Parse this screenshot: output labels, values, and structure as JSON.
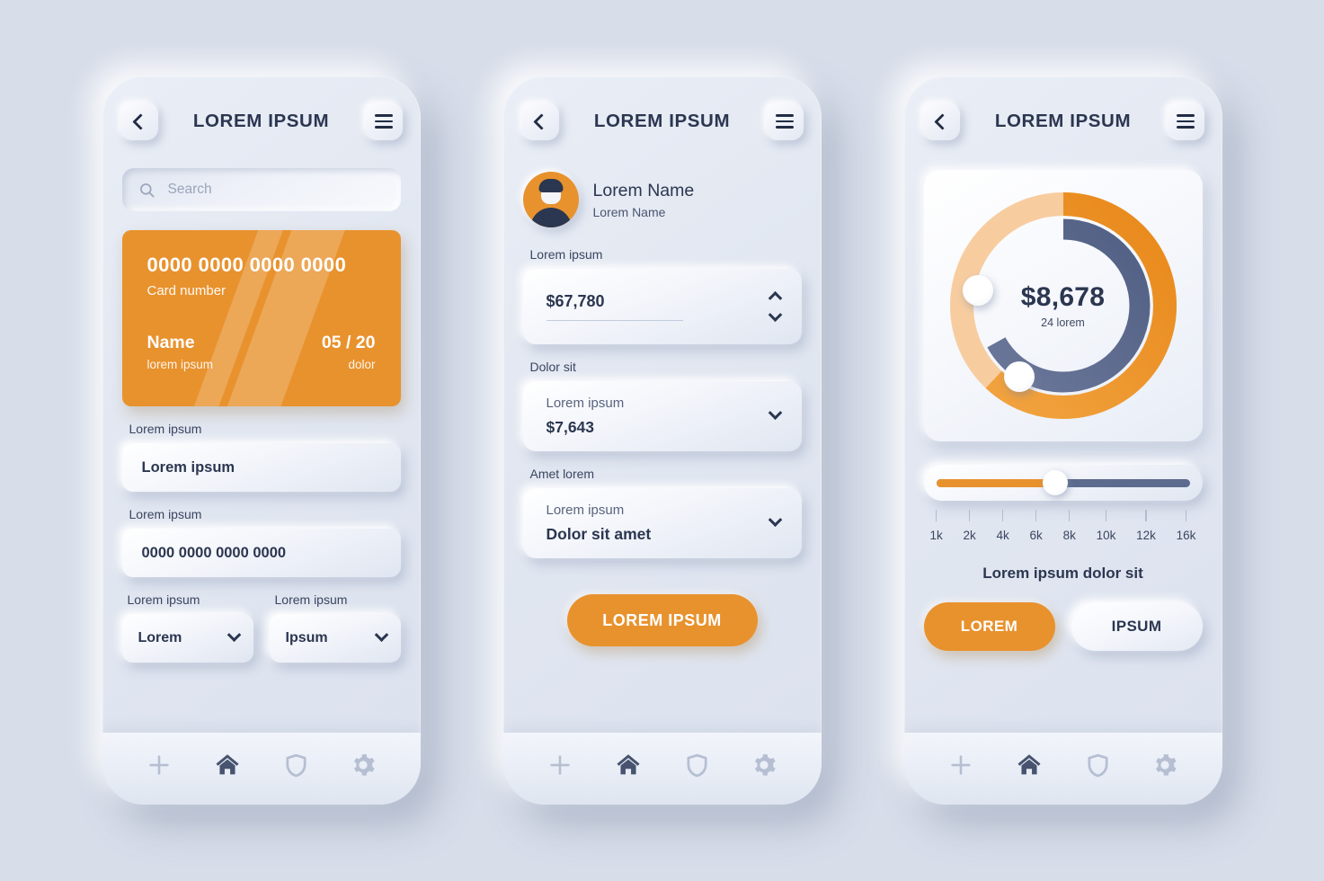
{
  "header": {
    "title": "LOREM IPSUM",
    "back_icon": "chevron-left-icon",
    "menu_icon": "hamburger-menu-icon"
  },
  "nav": {
    "add": "plus-icon",
    "home": "home-icon",
    "shield": "shield-icon",
    "settings": "gear-icon"
  },
  "screen1": {
    "search": {
      "placeholder": "Search",
      "icon": "search-icon"
    },
    "card": {
      "number": "0000 0000 0000 0000",
      "number_label": "Card number",
      "name": "Name",
      "name_label": "lorem ipsum",
      "expiry": "05 / 20",
      "expiry_label": "dolor",
      "color": "#e8922e"
    },
    "field1": {
      "label": "Lorem ipsum",
      "value": "Lorem ipsum"
    },
    "field2": {
      "label": "Lorem ipsum",
      "value": "0000 0000 0000 0000"
    },
    "select1": {
      "label": "Lorem ipsum",
      "value": "Lorem"
    },
    "select2": {
      "label": "Lorem ipsum",
      "value": "Ipsum"
    }
  },
  "screen2": {
    "profile": {
      "name": "Lorem Name",
      "subtitle": "Lorem Name",
      "avatar": "user-avatar-icon"
    },
    "stepper": {
      "label": "Lorem ipsum",
      "value": "$67,780"
    },
    "dropdown1": {
      "label": "Dolor sit",
      "hint": "Lorem ipsum",
      "value": "$7,643"
    },
    "dropdown2": {
      "label": "Amet lorem",
      "hint": "Lorem ipsum",
      "value": "Dolor sit amet"
    },
    "cta": "LOREM IPSUM"
  },
  "screen3": {
    "donut": {
      "amount": "$8,678",
      "caption": "24 lorem"
    },
    "slider": {
      "value_pct": 47
    },
    "chart_caption": "Lorem ipsum dolor sit",
    "pill_primary": "LOREM",
    "pill_secondary": "IPSUM"
  },
  "chart_data": {
    "type": "pie",
    "title": "$8,678",
    "subtitle": "24 lorem",
    "rings": [
      {
        "name": "outer",
        "filled_pct": 62,
        "filled_color": "#ec8d22",
        "track_color": "#f6cb9c",
        "start_angle_deg": 0
      },
      {
        "name": "inner",
        "filled_pct": 67,
        "filled_color": "#5c6b8e",
        "track_color": "#ffffff",
        "start_angle_deg": 0
      }
    ],
    "slider": {
      "type": "line",
      "categories": [
        "1k",
        "2k",
        "4k",
        "6k",
        "8k",
        "10k",
        "12k",
        "16k"
      ],
      "value": "6k",
      "value_pct": 47,
      "fill_color": "#e8922e",
      "track_color": "#5c6b8e"
    }
  }
}
